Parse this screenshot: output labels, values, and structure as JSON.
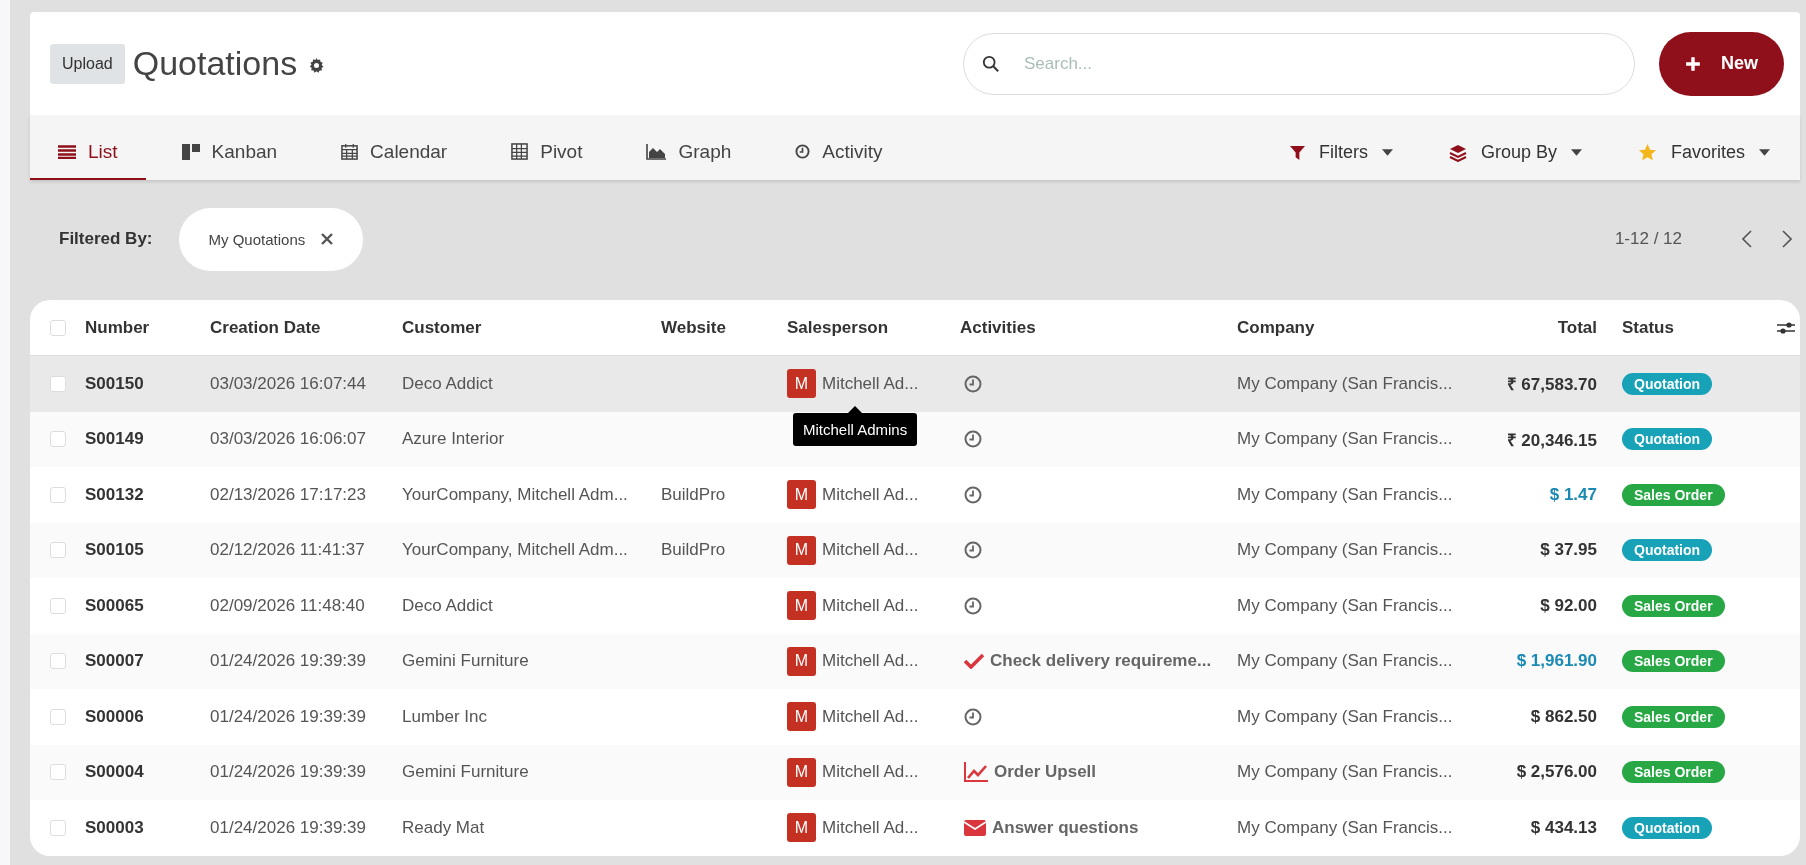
{
  "header": {
    "upload_button": "Upload",
    "title": "Quotations",
    "search": {
      "placeholder": "Search..."
    },
    "new_button": "New"
  },
  "views": [
    {
      "label": "List",
      "selected": true
    },
    {
      "label": "Kanban",
      "selected": false
    },
    {
      "label": "Calendar",
      "selected": false
    },
    {
      "label": "Pivot",
      "selected": false
    },
    {
      "label": "Graph",
      "selected": false
    },
    {
      "label": "Activity",
      "selected": false
    }
  ],
  "search_menus": [
    {
      "label": "Filters"
    },
    {
      "label": "Group By"
    },
    {
      "label": "Favorites"
    }
  ],
  "filter_bar": {
    "label": "Filtered By:",
    "facets": [
      "My Quotations"
    ]
  },
  "pager": "1-12 / 12",
  "table": {
    "select_all_checked": false,
    "columns": [
      "Number",
      "Creation Date",
      "Customer",
      "Website",
      "Salesperson",
      "Activities",
      "Company",
      "Total",
      "Status"
    ],
    "rows": [
      {
        "number": "S00150",
        "date": "03/03/2026 16:07:44",
        "customer": "Deco Addict",
        "salesperson": {
          "avatar": "M",
          "name": "Mitchell Ad...",
          "tooltip": "Mitchell Admins"
        },
        "activity": {
          "kind": "clock"
        },
        "company": "My Company (San Francis...",
        "total": "₹ 67,583.70",
        "total_highlighted": false,
        "status": {
          "label": "Quotation",
          "color": "#17a2b8"
        },
        "hovered": true,
        "checked": false
      },
      {
        "number": "S00149",
        "date": "03/03/2026 16:06:07",
        "customer": "Azure Interior",
        "activity": {
          "kind": "clock"
        },
        "company": "My Company (San Francis...",
        "total": "₹ 20,346.15",
        "total_highlighted": false,
        "status": {
          "label": "Quotation",
          "color": "#17a2b8"
        },
        "hovered": false,
        "checked": false
      },
      {
        "number": "S00132",
        "date": "02/13/2026 17:17:23",
        "customer": "YourCompany, Mitchell Adm...",
        "website": "BuildPro",
        "salesperson": {
          "avatar": "M",
          "name": "Mitchell Ad..."
        },
        "activity": {
          "kind": "clock"
        },
        "company": "My Company (San Francis...",
        "total": "$ 1.47",
        "total_highlighted": true,
        "status": {
          "label": "Sales Order",
          "color": "#28a745"
        },
        "hovered": false,
        "checked": false
      },
      {
        "number": "S00105",
        "date": "02/12/2026 11:41:37",
        "customer": "YourCompany, Mitchell Adm...",
        "website": "BuildPro",
        "salesperson": {
          "avatar": "M",
          "name": "Mitchell Ad..."
        },
        "activity": {
          "kind": "clock"
        },
        "company": "My Company (San Francis...",
        "total": "$ 37.95",
        "total_highlighted": false,
        "status": {
          "label": "Quotation",
          "color": "#17a2b8"
        },
        "hovered": false,
        "checked": false
      },
      {
        "number": "S00065",
        "date": "02/09/2026 11:48:40",
        "customer": "Deco Addict",
        "salesperson": {
          "avatar": "M",
          "name": "Mitchell Ad..."
        },
        "activity": {
          "kind": "clock"
        },
        "company": "My Company (San Francis...",
        "total": "$ 92.00",
        "total_highlighted": false,
        "status": {
          "label": "Sales Order",
          "color": "#28a745"
        },
        "hovered": false,
        "checked": false
      },
      {
        "number": "S00007",
        "date": "01/24/2026 19:39:39",
        "customer": "Gemini Furniture",
        "salesperson": {
          "avatar": "M",
          "name": "Mitchell Ad..."
        },
        "activity": {
          "kind": "check",
          "text": "Check delivery requireme..."
        },
        "company": "My Company (San Francis...",
        "total": "$ 1,961.90",
        "total_highlighted": true,
        "status": {
          "label": "Sales Order",
          "color": "#28a745"
        },
        "hovered": false,
        "checked": false
      },
      {
        "number": "S00006",
        "date": "01/24/2026 19:39:39",
        "customer": "Lumber Inc",
        "salesperson": {
          "avatar": "M",
          "name": "Mitchell Ad..."
        },
        "activity": {
          "kind": "clock"
        },
        "company": "My Company (San Francis...",
        "total": "$ 862.50",
        "total_highlighted": false,
        "status": {
          "label": "Sales Order",
          "color": "#28a745"
        },
        "hovered": false,
        "checked": false
      },
      {
        "number": "S00004",
        "date": "01/24/2026 19:39:39",
        "customer": "Gemini Furniture",
        "salesperson": {
          "avatar": "M",
          "name": "Mitchell Ad..."
        },
        "activity": {
          "kind": "trend",
          "text": "Order Upsell"
        },
        "company": "My Company (San Francis...",
        "total": "$ 2,576.00",
        "total_highlighted": false,
        "status": {
          "label": "Sales Order",
          "color": "#28a745"
        },
        "hovered": false,
        "checked": false
      },
      {
        "number": "S00003",
        "date": "01/24/2026 19:39:39",
        "customer": "Ready Mat",
        "salesperson": {
          "avatar": "M",
          "name": "Mitchell Ad..."
        },
        "activity": {
          "kind": "mail",
          "text": "Answer questions"
        },
        "company": "My Company (San Francis...",
        "total": "$ 434.13",
        "total_highlighted": false,
        "status": {
          "label": "Quotation",
          "color": "#17a2b8"
        },
        "hovered": false,
        "checked": false
      }
    ]
  }
}
